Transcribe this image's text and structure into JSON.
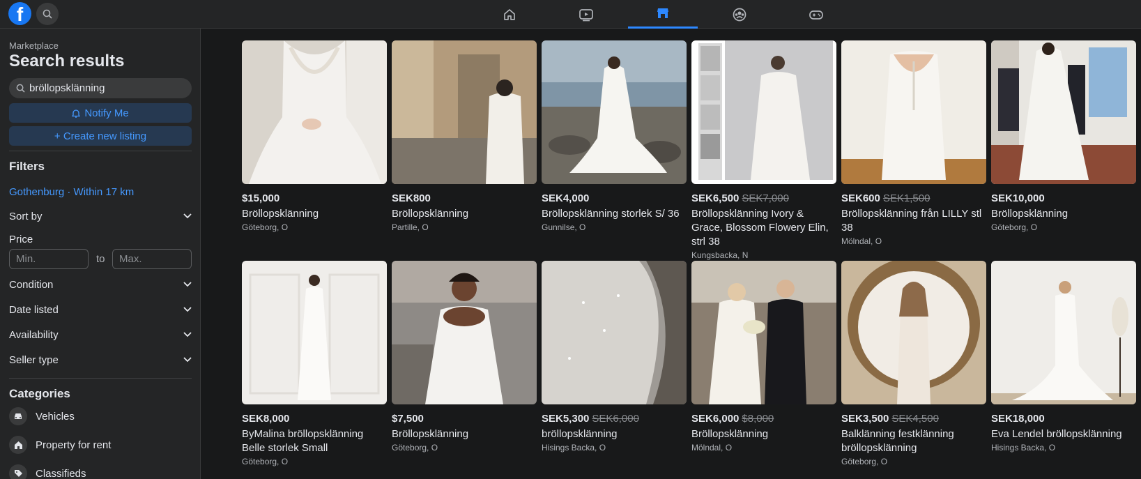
{
  "app": {
    "logo_letter": "f"
  },
  "nav": {
    "tabs": [
      {
        "name": "home-icon"
      },
      {
        "name": "video-icon"
      },
      {
        "name": "marketplace-icon"
      },
      {
        "name": "groups-icon"
      },
      {
        "name": "gaming-icon"
      }
    ]
  },
  "sidebar": {
    "breadcrumb": "Marketplace",
    "title": "Search results",
    "search_value": "bröllopsklänning",
    "notify_label": "Notify Me",
    "create_label": "+ Create new listing",
    "filters_heading": "Filters",
    "location": "Gothenburg · Within 17 km",
    "sort_by": "Sort by",
    "price_label": "Price",
    "min_placeholder": "Min.",
    "max_placeholder": "Max.",
    "to_label": "to",
    "condition": "Condition",
    "date_listed": "Date listed",
    "availability": "Availability",
    "seller_type": "Seller type",
    "categories_heading": "Categories",
    "categories": [
      {
        "label": "Vehicles",
        "icon": "car-icon"
      },
      {
        "label": "Property for rent",
        "icon": "house-icon"
      },
      {
        "label": "Classifieds",
        "icon": "tag-icon"
      }
    ]
  },
  "listings": [
    {
      "price": "$15,000",
      "old_price": "",
      "title": "Bröllopsklänning",
      "location": "Göteborg, O"
    },
    {
      "price": "SEK800",
      "old_price": "",
      "title": "Bröllopsklänning",
      "location": "Partille, O"
    },
    {
      "price": "SEK4,000",
      "old_price": "",
      "title": "Bröllopsklänning storlek S/ 36",
      "location": "Gunnilse, O"
    },
    {
      "price": "SEK6,500",
      "old_price": "SEK7,000",
      "title": "Bröllopsklänning Ivory & Grace, Blossom Flowery Elin, strl 38",
      "location": "Kungsbacka, N"
    },
    {
      "price": "SEK600",
      "old_price": "SEK1,500",
      "title": "Bröllopsklänning från LILLY stl 38",
      "location": "Mölndal, O"
    },
    {
      "price": "SEK10,000",
      "old_price": "",
      "title": "Bröllopsklänning",
      "location": "Göteborg, O"
    },
    {
      "price": "SEK8,000",
      "old_price": "",
      "title": "ByMalina bröllopsklänning Belle storlek Small",
      "location": "Göteborg, O"
    },
    {
      "price": "$7,500",
      "old_price": "",
      "title": "Bröllopsklänning",
      "location": "Göteborg, O"
    },
    {
      "price": "SEK5,300",
      "old_price": "SEK6,000",
      "title": "bröllopsklänning",
      "location": "Hisings Backa, O"
    },
    {
      "price": "SEK6,000",
      "old_price": "$8,000",
      "title": "Bröllopsklänning",
      "location": "Mölndal, O"
    },
    {
      "price": "SEK3,500",
      "old_price": "SEK4,500",
      "title": "Balklänning festklänning bröllopsklänning",
      "location": "Göteborg, O"
    },
    {
      "price": "SEK18,000",
      "old_price": "",
      "title": "Eva Lendel bröllopsklänning",
      "location": "Hisings Backa, O"
    }
  ],
  "colors": {
    "accent": "#2d88ff",
    "link": "#4599ff",
    "bg": "#18191a",
    "panel": "#242526"
  }
}
